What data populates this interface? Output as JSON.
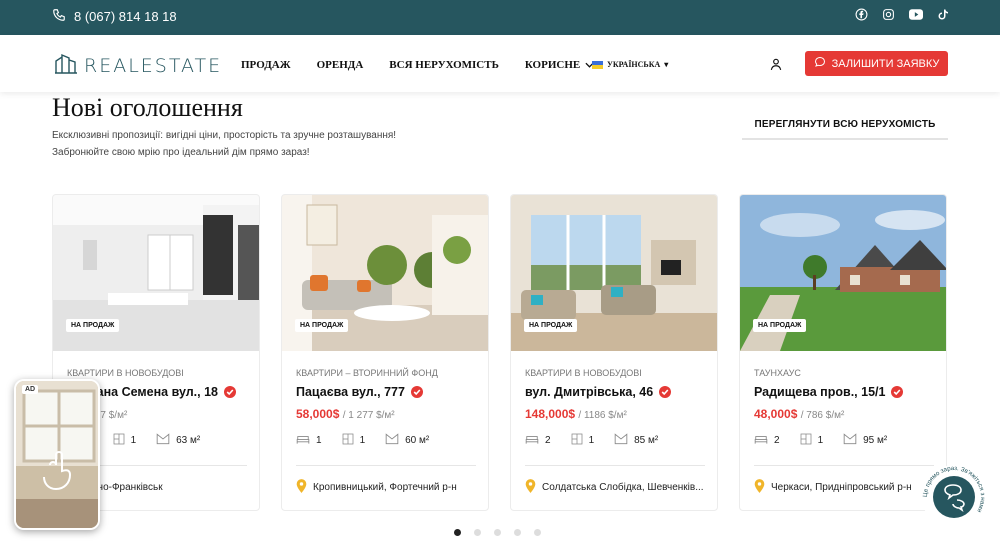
{
  "topbar": {
    "phone": "8 (067) 814 18 18",
    "socials": [
      "facebook-icon",
      "instagram-icon",
      "youtube-icon",
      "tiktok-icon"
    ],
    "color": "#26565f"
  },
  "header": {
    "logo_text": "REALESTATE",
    "nav": [
      {
        "label": "ПРОДАЖ"
      },
      {
        "label": "ОРЕНДА"
      },
      {
        "label": "ВСЯ НЕРУХОМІСТЬ"
      },
      {
        "label": "КОРИСНЕ",
        "dropdown": true
      }
    ],
    "language": "УКРАЇНСЬКА",
    "cta_label": "ЗАЛИШИТИ ЗАЯВКУ",
    "cta_color": "#e53935"
  },
  "section": {
    "title": "Нові оголошення",
    "subtitle_line1": "Ексклюзивні пропозиції: вигідні ціни, просторість та зручне розташування!",
    "subtitle_line2": "Забронюйте свою мрію про ідеальний дім прямо зараз!",
    "view_all": "ПЕРЕГЛЯНУТИ ВСЮ НЕРУХОМІСТЬ"
  },
  "listings": [
    {
      "badge": "НА ПРОДАЖ",
      "category": "КВАРТИРИ В НОВОБУДОВІ",
      "address": "Степана Семена вул., 18",
      "price": "0$",
      "price_per_m2": "/ 677 $/м²",
      "rooms": "1",
      "floors": "1",
      "area": "63 м²",
      "location": "Івано-Франківськ"
    },
    {
      "badge": "НА ПРОДАЖ",
      "category": "КВАРТИРИ – ВТОРИННИЙ ФОНД",
      "address": "Пацаєва вул., 777",
      "price": "58,000$",
      "price_per_m2": "/ 1 277 $/м²",
      "rooms": "1",
      "floors": "1",
      "area": "60 м²",
      "location": "Кропивницький, Фортечний р-н"
    },
    {
      "badge": "НА ПРОДАЖ",
      "category": "КВАРТИРИ В НОВОБУДОВІ",
      "address": "вул. Дмитрівська, 46",
      "price": "148,000$",
      "price_per_m2": "/ 1186 $/м²",
      "rooms": "2",
      "floors": "1",
      "area": "85 м²",
      "location": "Солдатська Слобідка, Шевченків..."
    },
    {
      "badge": "НА ПРОДАЖ",
      "category": "ТАУНХАУС",
      "address": "Радищева пров., 15/1",
      "price": "48,000$",
      "price_per_m2": "/ 786 $/м²",
      "rooms": "2",
      "floors": "1",
      "area": "95 м²",
      "location": "Черкаси, Придніпровський р-н"
    }
  ],
  "carousel": {
    "pages": 5,
    "active": 1
  },
  "ad": {
    "badge": "AD"
  },
  "chat_widget": {
    "ring_text": "Це прямо зараз. Зв'яжіться з нами"
  }
}
